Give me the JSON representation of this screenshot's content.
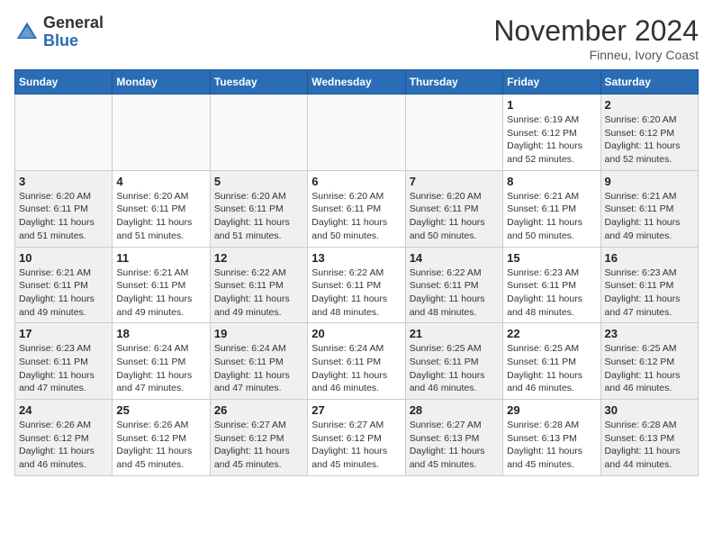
{
  "header": {
    "logo_line1": "General",
    "logo_line2": "Blue",
    "month": "November 2024",
    "location": "Finneu, Ivory Coast"
  },
  "weekdays": [
    "Sunday",
    "Monday",
    "Tuesday",
    "Wednesday",
    "Thursday",
    "Friday",
    "Saturday"
  ],
  "weeks": [
    [
      {
        "day": "",
        "info": ""
      },
      {
        "day": "",
        "info": ""
      },
      {
        "day": "",
        "info": ""
      },
      {
        "day": "",
        "info": ""
      },
      {
        "day": "",
        "info": ""
      },
      {
        "day": "1",
        "info": "Sunrise: 6:19 AM\nSunset: 6:12 PM\nDaylight: 11 hours\nand 52 minutes."
      },
      {
        "day": "2",
        "info": "Sunrise: 6:20 AM\nSunset: 6:12 PM\nDaylight: 11 hours\nand 52 minutes."
      }
    ],
    [
      {
        "day": "3",
        "info": "Sunrise: 6:20 AM\nSunset: 6:11 PM\nDaylight: 11 hours\nand 51 minutes."
      },
      {
        "day": "4",
        "info": "Sunrise: 6:20 AM\nSunset: 6:11 PM\nDaylight: 11 hours\nand 51 minutes."
      },
      {
        "day": "5",
        "info": "Sunrise: 6:20 AM\nSunset: 6:11 PM\nDaylight: 11 hours\nand 51 minutes."
      },
      {
        "day": "6",
        "info": "Sunrise: 6:20 AM\nSunset: 6:11 PM\nDaylight: 11 hours\nand 50 minutes."
      },
      {
        "day": "7",
        "info": "Sunrise: 6:20 AM\nSunset: 6:11 PM\nDaylight: 11 hours\nand 50 minutes."
      },
      {
        "day": "8",
        "info": "Sunrise: 6:21 AM\nSunset: 6:11 PM\nDaylight: 11 hours\nand 50 minutes."
      },
      {
        "day": "9",
        "info": "Sunrise: 6:21 AM\nSunset: 6:11 PM\nDaylight: 11 hours\nand 49 minutes."
      }
    ],
    [
      {
        "day": "10",
        "info": "Sunrise: 6:21 AM\nSunset: 6:11 PM\nDaylight: 11 hours\nand 49 minutes."
      },
      {
        "day": "11",
        "info": "Sunrise: 6:21 AM\nSunset: 6:11 PM\nDaylight: 11 hours\nand 49 minutes."
      },
      {
        "day": "12",
        "info": "Sunrise: 6:22 AM\nSunset: 6:11 PM\nDaylight: 11 hours\nand 49 minutes."
      },
      {
        "day": "13",
        "info": "Sunrise: 6:22 AM\nSunset: 6:11 PM\nDaylight: 11 hours\nand 48 minutes."
      },
      {
        "day": "14",
        "info": "Sunrise: 6:22 AM\nSunset: 6:11 PM\nDaylight: 11 hours\nand 48 minutes."
      },
      {
        "day": "15",
        "info": "Sunrise: 6:23 AM\nSunset: 6:11 PM\nDaylight: 11 hours\nand 48 minutes."
      },
      {
        "day": "16",
        "info": "Sunrise: 6:23 AM\nSunset: 6:11 PM\nDaylight: 11 hours\nand 47 minutes."
      }
    ],
    [
      {
        "day": "17",
        "info": "Sunrise: 6:23 AM\nSunset: 6:11 PM\nDaylight: 11 hours\nand 47 minutes."
      },
      {
        "day": "18",
        "info": "Sunrise: 6:24 AM\nSunset: 6:11 PM\nDaylight: 11 hours\nand 47 minutes."
      },
      {
        "day": "19",
        "info": "Sunrise: 6:24 AM\nSunset: 6:11 PM\nDaylight: 11 hours\nand 47 minutes."
      },
      {
        "day": "20",
        "info": "Sunrise: 6:24 AM\nSunset: 6:11 PM\nDaylight: 11 hours\nand 46 minutes."
      },
      {
        "day": "21",
        "info": "Sunrise: 6:25 AM\nSunset: 6:11 PM\nDaylight: 11 hours\nand 46 minutes."
      },
      {
        "day": "22",
        "info": "Sunrise: 6:25 AM\nSunset: 6:11 PM\nDaylight: 11 hours\nand 46 minutes."
      },
      {
        "day": "23",
        "info": "Sunrise: 6:25 AM\nSunset: 6:12 PM\nDaylight: 11 hours\nand 46 minutes."
      }
    ],
    [
      {
        "day": "24",
        "info": "Sunrise: 6:26 AM\nSunset: 6:12 PM\nDaylight: 11 hours\nand 46 minutes."
      },
      {
        "day": "25",
        "info": "Sunrise: 6:26 AM\nSunset: 6:12 PM\nDaylight: 11 hours\nand 45 minutes."
      },
      {
        "day": "26",
        "info": "Sunrise: 6:27 AM\nSunset: 6:12 PM\nDaylight: 11 hours\nand 45 minutes."
      },
      {
        "day": "27",
        "info": "Sunrise: 6:27 AM\nSunset: 6:12 PM\nDaylight: 11 hours\nand 45 minutes."
      },
      {
        "day": "28",
        "info": "Sunrise: 6:27 AM\nSunset: 6:13 PM\nDaylight: 11 hours\nand 45 minutes."
      },
      {
        "day": "29",
        "info": "Sunrise: 6:28 AM\nSunset: 6:13 PM\nDaylight: 11 hours\nand 45 minutes."
      },
      {
        "day": "30",
        "info": "Sunrise: 6:28 AM\nSunset: 6:13 PM\nDaylight: 11 hours\nand 44 minutes."
      }
    ]
  ]
}
